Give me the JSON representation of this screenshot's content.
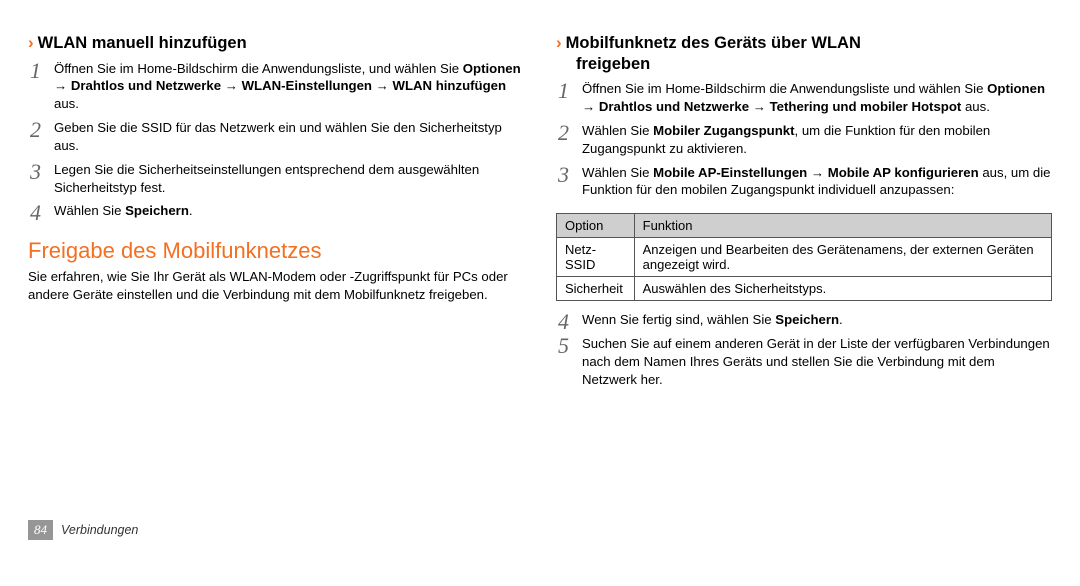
{
  "left": {
    "subhead": "WLAN manuell hinzufügen",
    "steps": [
      {
        "pre": "Öffnen Sie im Home-Bildschirm die Anwendungsliste, und wählen Sie ",
        "bold": "Optionen → Drahtlos und Netzwerke → WLAN-Einstellungen → WLAN hinzufügen",
        "post": " aus."
      },
      {
        "pre": "Geben Sie die SSID für das Netzwerk ein und wählen Sie den Sicherheitstyp aus.",
        "bold": "",
        "post": ""
      },
      {
        "pre": "Legen Sie die Sicherheitseinstellungen entsprechend dem ausgewählten Sicherheitstyp fest.",
        "bold": "",
        "post": ""
      },
      {
        "pre": "Wählen Sie ",
        "bold": "Speichern",
        "post": "."
      }
    ],
    "section": "Freigabe des Mobilfunknetzes",
    "para": "Sie erfahren, wie Sie Ihr Gerät als WLAN-Modem oder -Zugriffspunkt für PCs oder andere Geräte einstellen und die Verbindung mit dem Mobilfunknetz freigeben."
  },
  "right": {
    "subhead_line1": "Mobilfunknetz des Geräts über WLAN",
    "subhead_line2": "freigeben",
    "steps": [
      {
        "pre": "Öffnen Sie im Home-Bildschirm die Anwendungsliste und wählen Sie ",
        "bold": "Optionen → Drahtlos und Netzwerke → Tethering und mobiler Hotspot",
        "post": " aus."
      },
      {
        "pre": "Wählen Sie ",
        "bold": "Mobiler Zugangspunkt",
        "post": ", um die Funktion für den mobilen Zugangspunkt zu aktivieren."
      },
      {
        "pre": "Wählen Sie ",
        "bold": "Mobile AP-Einstellungen → Mobile AP konfigurieren",
        "post": " aus, um die Funktion für den mobilen Zugangspunkt individuell anzupassen:"
      }
    ],
    "table": {
      "head": [
        "Option",
        "Funktion"
      ],
      "rows": [
        [
          "Netz-SSID",
          "Anzeigen und Bearbeiten des Gerätenamens, der externen Geräten angezeigt wird."
        ],
        [
          "Sicherheit",
          "Auswählen des Sicherheitstyps."
        ]
      ]
    },
    "steps_after": [
      {
        "pre": "Wenn Sie fertig sind, wählen Sie ",
        "bold": "Speichern",
        "post": "."
      },
      {
        "pre": "Suchen Sie auf einem anderen Gerät in der Liste der verfügbaren Verbindungen nach dem Namen Ihres Geräts und stellen Sie die Verbindung mit dem Netzwerk her.",
        "bold": "",
        "post": ""
      }
    ]
  },
  "footer": {
    "pagenum": "84",
    "section": "Verbindungen"
  }
}
